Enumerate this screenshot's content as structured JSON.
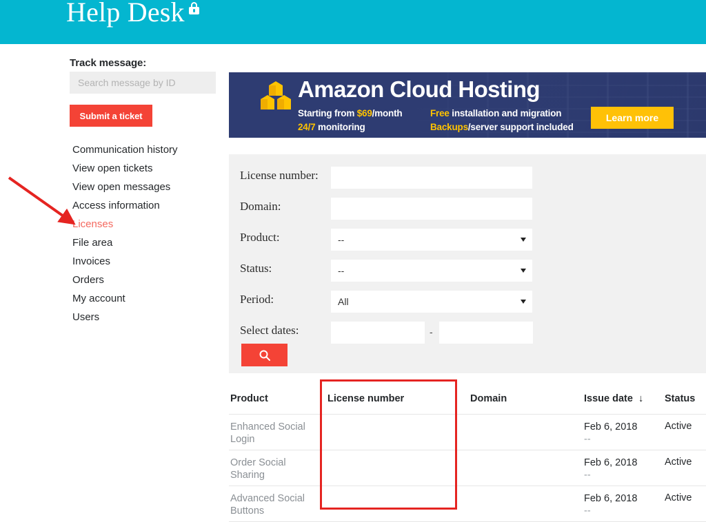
{
  "header": {
    "brand": "Help Desk",
    "lock_icon": "lock-icon",
    "background": "#04b6d0"
  },
  "sidebar": {
    "track_label": "Track message:",
    "search": {
      "placeholder": "Search message by ID",
      "value": ""
    },
    "submit_button": "Submit a ticket",
    "items": [
      {
        "label": "Communication history",
        "active": false
      },
      {
        "label": "View open tickets",
        "active": false
      },
      {
        "label": "View open messages",
        "active": false
      },
      {
        "label": "Access information",
        "active": false
      },
      {
        "label": "Licenses",
        "active": true
      },
      {
        "label": "File area",
        "active": false
      },
      {
        "label": "Invoices",
        "active": false
      },
      {
        "label": "Orders",
        "active": false
      },
      {
        "label": "My account",
        "active": false
      },
      {
        "label": "Users",
        "active": false
      }
    ],
    "active_color": "#f4685e"
  },
  "annotations": {
    "arrow_color": "#e52421",
    "arrow_target": "Licenses",
    "rect_color": "#e52421",
    "rect_target": "License number column"
  },
  "banner": {
    "title": "Amazon Cloud Hosting",
    "icon": "aws-cubes-icon",
    "line1_highlight": "Starting from ",
    "line1_accent": "$69",
    "line1_rest": "/month",
    "line2_accent": "24/7",
    "line2_rest": " monitoring",
    "line3_accent": "Free",
    "line3_rest": " installation and migration",
    "line4_accent": "Backups",
    "line4_rest": "/server support included",
    "cta": "Learn more",
    "bg_color": "#2e3c72",
    "accent_color": "#ffc300",
    "cta_color": "#ffc107"
  },
  "filters": {
    "rows": [
      {
        "label": "License number:",
        "type": "text",
        "value": "",
        "placeholder": ""
      },
      {
        "label": "Domain:",
        "type": "text",
        "value": "",
        "placeholder": ""
      },
      {
        "label": "Product:",
        "type": "select",
        "value": "--"
      },
      {
        "label": "Status:",
        "type": "select",
        "value": "--"
      },
      {
        "label": "Period:",
        "type": "select",
        "value": "All"
      }
    ],
    "dates_label": "Select dates:",
    "date_from": "",
    "date_to": "",
    "date_separator": "-",
    "search_icon": "magnifier-icon",
    "search_button_color": "#f44336"
  },
  "table": {
    "columns": [
      "Product",
      "License number",
      "Domain",
      "Issue date",
      "Status"
    ],
    "sort_column": "Issue date",
    "sort_indicator": "↓",
    "rows": [
      {
        "product": "Enhanced Social Login",
        "license": "",
        "license_redacted": true,
        "license_lines": 2,
        "domain": "",
        "issue_date": "Feb 6, 2018",
        "issue_date_sub": "--",
        "status": "Active"
      },
      {
        "product": "Order Social Sharing",
        "license": "",
        "license_redacted": true,
        "license_lines": 2,
        "domain": "",
        "issue_date": "Feb 6, 2018",
        "issue_date_sub": "--",
        "status": "Active"
      },
      {
        "product": "Advanced Social Buttons",
        "license": "",
        "license_redacted": true,
        "license_lines": 1,
        "domain": "",
        "issue_date": "Feb 6, 2018",
        "issue_date_sub": "--",
        "status": "Active"
      }
    ]
  }
}
